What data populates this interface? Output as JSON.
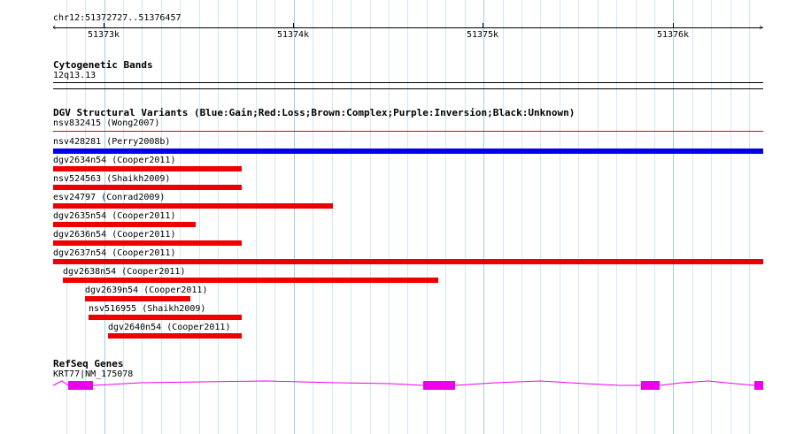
{
  "ruler": {
    "location": "chr12:51372727..51376457",
    "ticks": [
      "51373k",
      "51374k",
      "51375k",
      "51376k"
    ]
  },
  "cytoband": {
    "title": "Cytogenetic Bands",
    "band": "12q13.13"
  },
  "dgv": {
    "title": "DGV Structural Variants (Blue:Gain;Red:Loss;Brown:Complex;Purple:Inversion;Black:Unknown)",
    "colors": {
      "gain": "#0000ee",
      "loss": "#ee0000"
    },
    "variants": [
      {
        "label": "nsv832415 (Wong2007)",
        "type": "loss"
      },
      {
        "label": "nsv428281 (Perry2008b)",
        "type": "gain"
      },
      {
        "label": "dgv2634n54 (Cooper2011)",
        "type": "loss"
      },
      {
        "label": "nsv524563 (Shaikh2009)",
        "type": "loss"
      },
      {
        "label": "esv24797 (Conrad2009)",
        "type": "loss"
      },
      {
        "label": "dgv2635n54 (Cooper2011)",
        "type": "loss"
      },
      {
        "label": "dgv2636n54 (Cooper2011)",
        "type": "loss"
      },
      {
        "label": "dgv2637n54 (Cooper2011)",
        "type": "loss"
      },
      {
        "label": "dgv2638n54 (Cooper2011)",
        "type": "loss"
      },
      {
        "label": "dgv2639n54 (Cooper2011)",
        "type": "loss"
      },
      {
        "label": "nsv516955 (Shaikh2009)",
        "type": "loss"
      },
      {
        "label": "dgv2640n54 (Cooper2011)",
        "type": "loss"
      }
    ]
  },
  "refseq": {
    "title": "RefSeq Genes",
    "gene_label": "KRT77|NM_175078",
    "color": "#ee00ee"
  }
}
